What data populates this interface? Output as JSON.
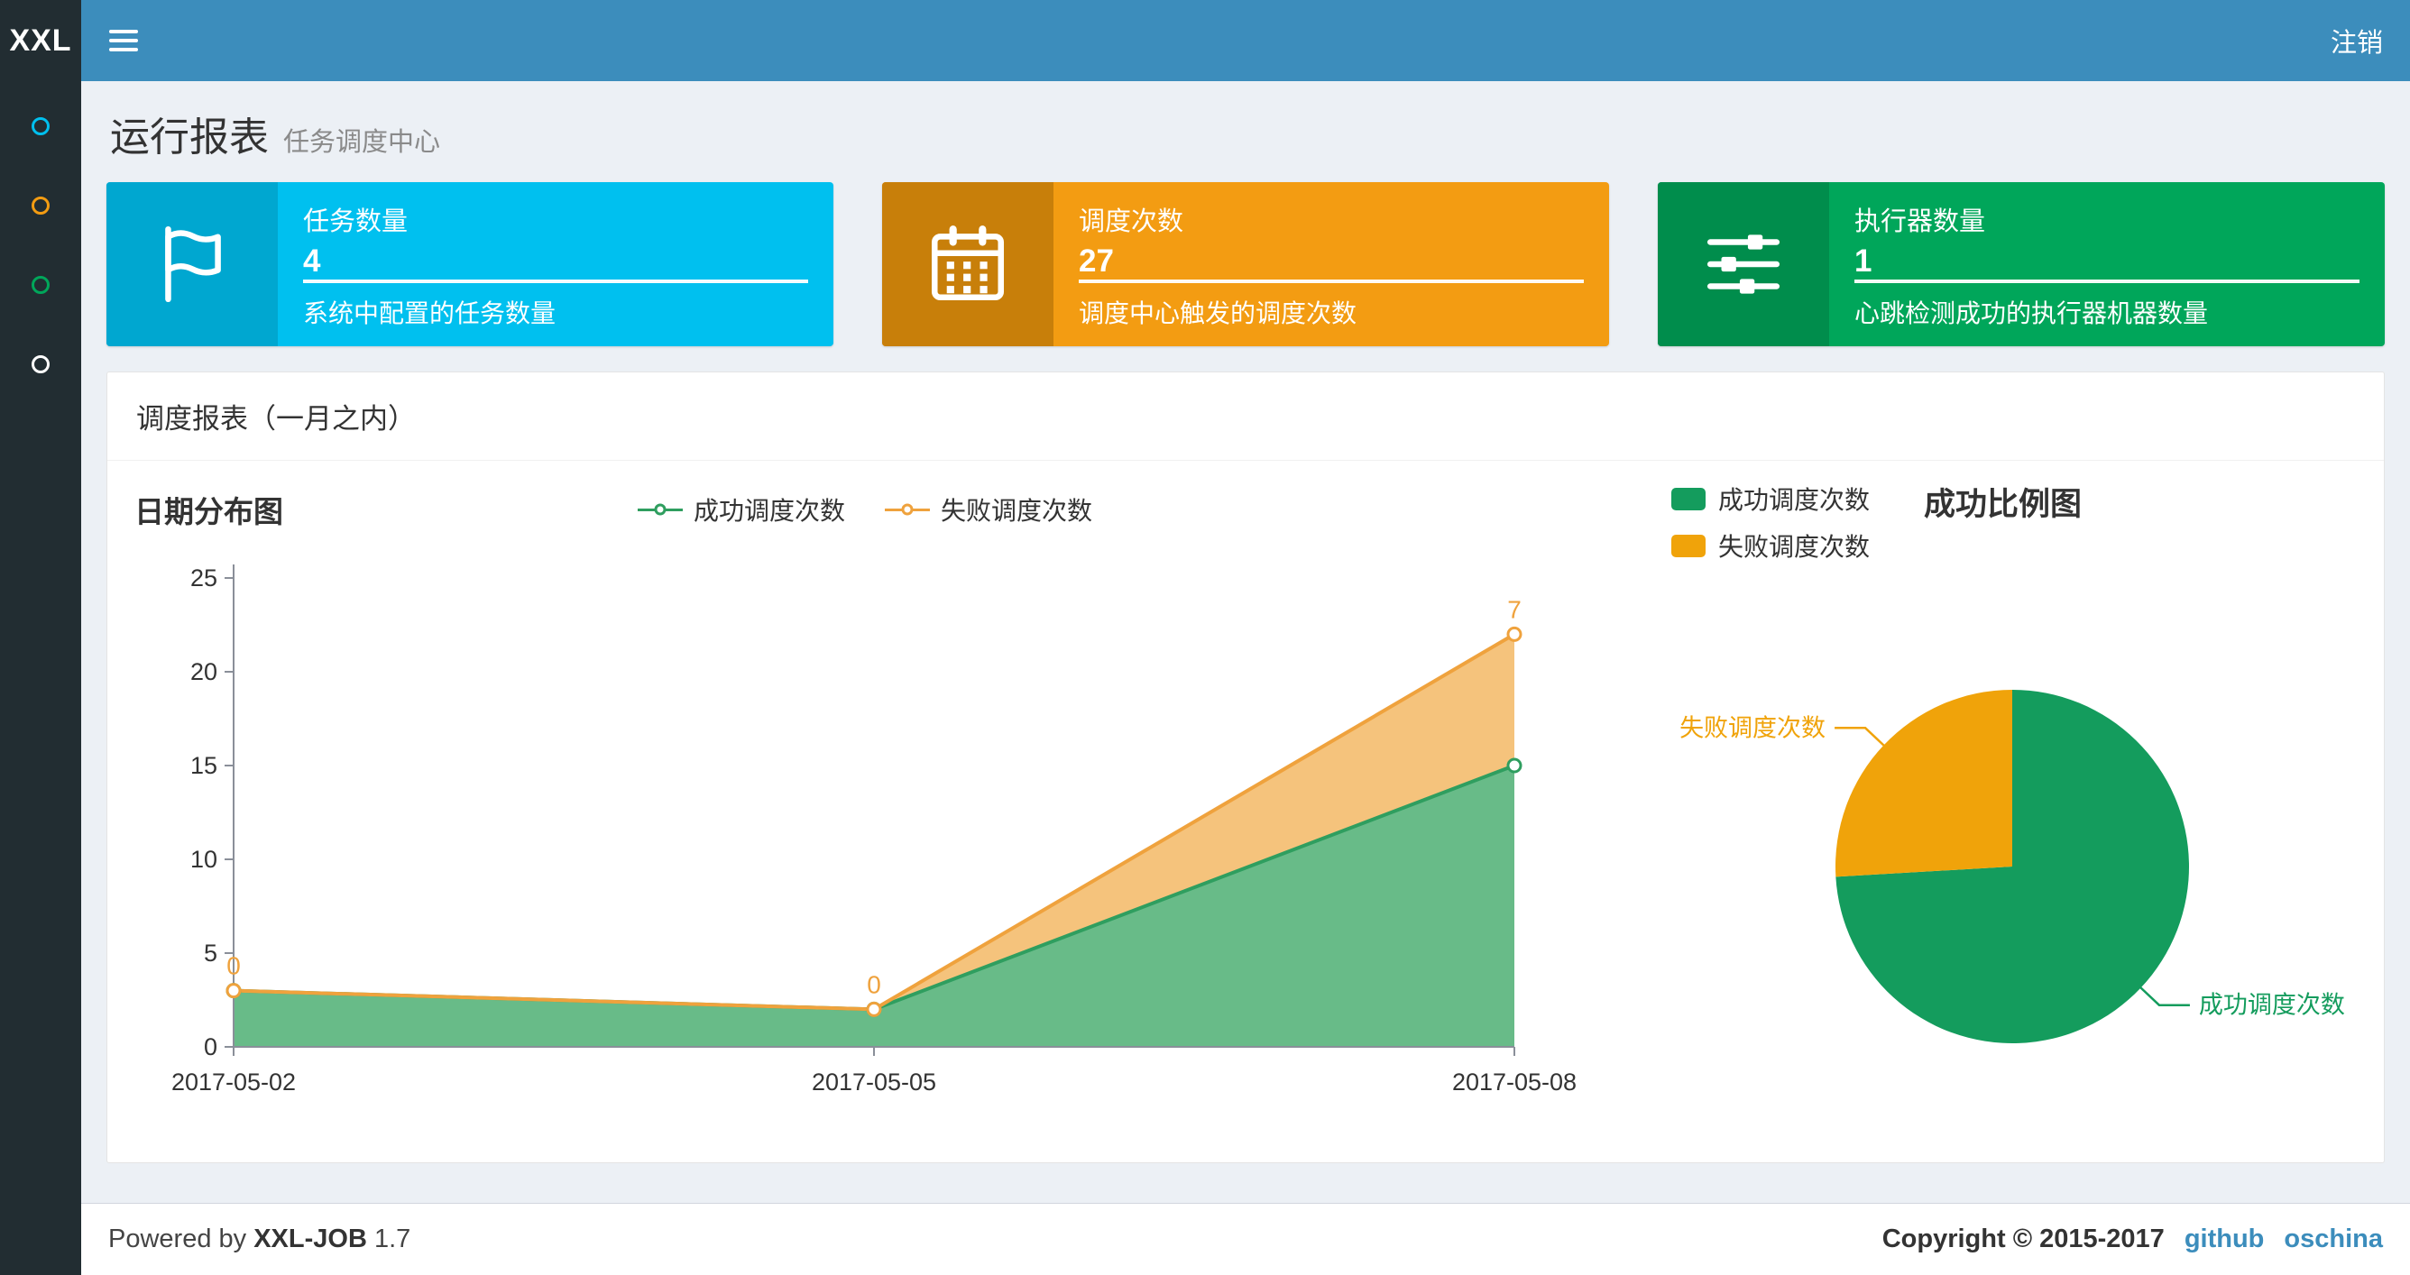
{
  "navbar": {
    "logo": "XXL",
    "logout": "注销"
  },
  "sidebar": {
    "items": [
      {
        "color": "#00c0ef"
      },
      {
        "color": "#f39c12"
      },
      {
        "color": "#00a65a"
      },
      {
        "color": "#ffffff"
      }
    ]
  },
  "page": {
    "title": "运行报表",
    "subtitle": "任务调度中心"
  },
  "info_boxes": [
    {
      "title": "任务数量",
      "value": "4",
      "desc": "系统中配置的任务数量",
      "color": "#00c0ef",
      "icon_color": "#00a7d0",
      "icon": "flag-icon"
    },
    {
      "title": "调度次数",
      "value": "27",
      "desc": "调度中心触发的调度次数",
      "color": "#f39c12",
      "icon_color": "#c87f0a",
      "icon": "calendar-icon"
    },
    {
      "title": "执行器数量",
      "value": "1",
      "desc": "心跳检测成功的执行器机器数量",
      "color": "#00a65a",
      "icon_color": "#008d4c",
      "icon": "sliders-icon"
    }
  ],
  "panel": {
    "title": "调度报表（一月之内）"
  },
  "chart_data": [
    {
      "type": "area",
      "title": "日期分布图",
      "stacked": true,
      "x": [
        "2017-05-02",
        "2017-05-05",
        "2017-05-08"
      ],
      "series": [
        {
          "name": "成功调度次数",
          "values": [
            3,
            2,
            15
          ],
          "line_color": "#2f9e5f",
          "fill_color": "#68bb88"
        },
        {
          "name": "失败调度次数",
          "values": [
            0,
            0,
            7
          ],
          "line_color": "#efa23d",
          "fill_color": "#f5c37c"
        }
      ],
      "ylim": [
        0,
        25
      ],
      "yticks": [
        0,
        5,
        10,
        15,
        20,
        25
      ],
      "legend_position": "top-center",
      "grid": false
    },
    {
      "type": "pie",
      "title": "成功比例图",
      "slices": [
        {
          "name": "成功调度次数",
          "value": 20,
          "color": "#149c5d"
        },
        {
          "name": "失败调度次数",
          "value": 7,
          "color": "#f0a30a"
        }
      ],
      "legend_position": "top-left"
    }
  ],
  "footer": {
    "powered_prefix": "Powered by",
    "product": "XXL-JOB",
    "version": "1.7",
    "copyright": "Copyright © 2015-2017",
    "links": [
      "github",
      "oschina"
    ]
  }
}
